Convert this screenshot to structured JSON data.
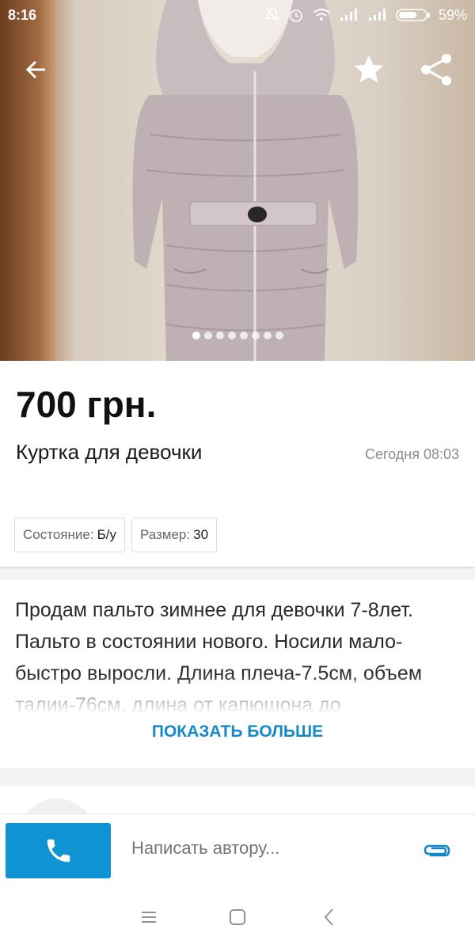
{
  "status_bar": {
    "time": "8:16",
    "battery": "59%",
    "icons": [
      "mute-icon",
      "alarm-icon",
      "wifi-icon",
      "signal-icon",
      "signal-icon",
      "battery-icon"
    ]
  },
  "photo": {
    "icons": {
      "back": "back-arrow-icon",
      "favorite": "star-icon",
      "share": "share-icon"
    },
    "page_count": 8,
    "active_page": 1
  },
  "listing": {
    "price": "700 грн.",
    "title": "Куртка для девочки",
    "date": "Сегодня 08:03",
    "params": [
      {
        "label": "Состояние:",
        "value": "Б/у"
      },
      {
        "label": "Размер:",
        "value": "30"
      }
    ]
  },
  "description": {
    "text": "Продам пальто зимнее для девочки 7-8лет. Пальто в состоянии нового. Носили мало-быстро выросли. Длина плеча-7.5см, объем талии-76см, длина от капюшона до",
    "show_more": "ПОКАЗАТЬ БОЛЬШЕ"
  },
  "action_bar": {
    "message_placeholder": "Написать автору...",
    "icons": {
      "call": "phone-icon",
      "attach": "paperclip-icon"
    }
  },
  "nav_bar": {
    "icons": [
      "menu-icon",
      "home-square-icon",
      "back-chevron-icon"
    ]
  },
  "colors": {
    "accent": "#0f93d2",
    "link": "#1589c8",
    "muted": "#8a8f93"
  }
}
